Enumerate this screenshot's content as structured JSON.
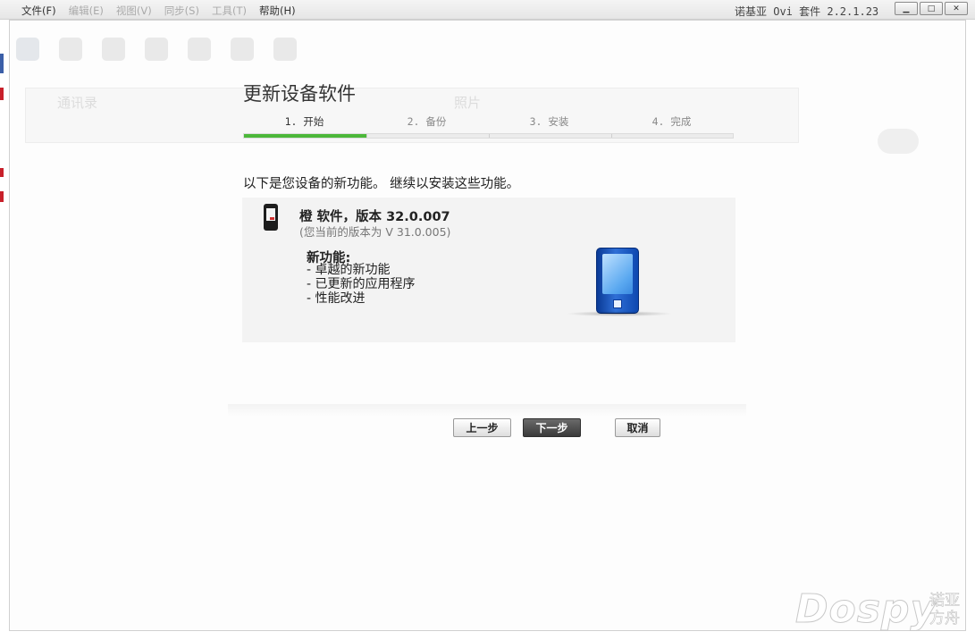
{
  "menu": {
    "items": [
      "文件(F)",
      "编辑(E)",
      "视图(V)",
      "同步(S)",
      "工具(T)",
      "帮助(H)"
    ]
  },
  "app": {
    "title": "诺基亚 Ovi 套件 2.2.1.23",
    "window_buttons": [
      "minimize-icon",
      "maximize-icon",
      "close-icon"
    ]
  },
  "background_app": {
    "contacts_label": "通讯录",
    "photos_label": "照片"
  },
  "wizard": {
    "title": "更新设备软件",
    "steps": [
      {
        "label": "1. 开始",
        "active": true
      },
      {
        "label": "2. 备份",
        "active": false
      },
      {
        "label": "3. 安装",
        "active": false
      },
      {
        "label": "4. 完成",
        "active": false
      }
    ],
    "progress_fraction": 0.25,
    "progress_color": "#4cb83a",
    "intro": "以下是您设备的新功能。 继续以安装这些功能。",
    "software": {
      "title": "橙 软件，版本 32.0.007",
      "current_version": "(您当前的版本为 V 31.0.005)"
    },
    "features_heading": "新功能:",
    "features": [
      "- 卓越的新功能",
      "- 已更新的应用程序",
      "- 性能改进"
    ],
    "buttons": {
      "back": "上一步",
      "next": "下一步",
      "cancel": "取消"
    }
  },
  "watermark": {
    "text": "Dospy",
    "sub": "诺亚方舟"
  }
}
